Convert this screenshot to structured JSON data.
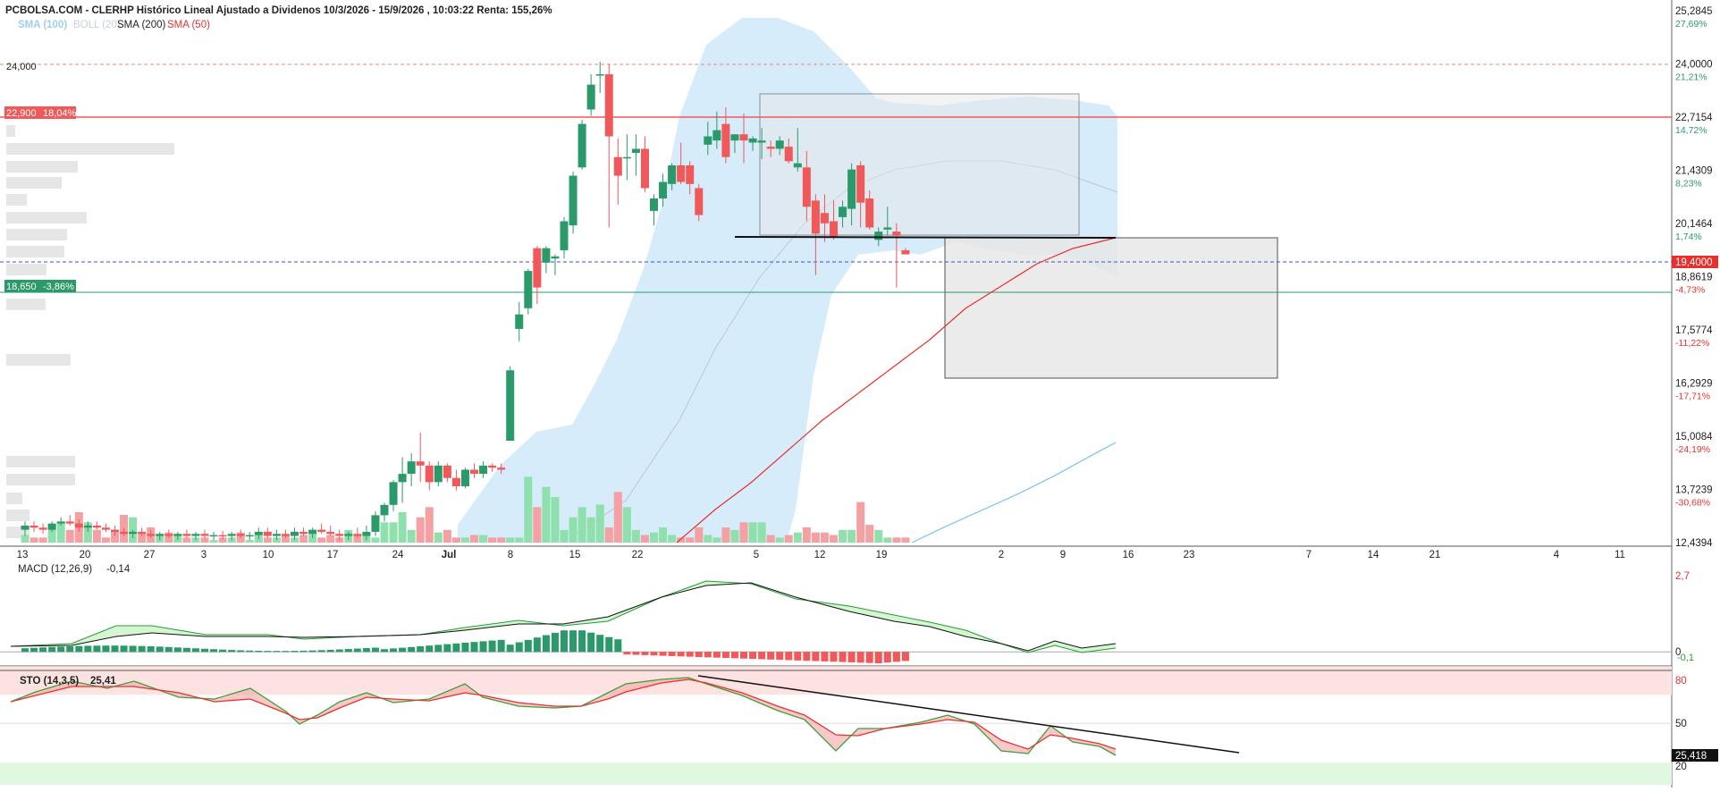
{
  "header": {
    "title": "PCBOLSA.COM - CLERHP Histórico Lineal Ajustado a Dividenos 10/3/2026 - 15/9/2026 , 10:03:22 Renta: 155,26%",
    "legend": [
      {
        "label": "SMA (100)",
        "color": "#9ecff0"
      },
      {
        "label": "BOLL (20)",
        "color": "#d0d8e0"
      },
      {
        "label": "SMA (200)",
        "color": "#222222"
      },
      {
        "label": "SMA (50)",
        "color": "#e8312f"
      }
    ]
  },
  "colors": {
    "up": "#2a9a6a",
    "down": "#f0585a",
    "up_vol": "#8fe0ad",
    "down_vol": "#f5a0a2",
    "boll": "#cfe9fa",
    "sma50": "#e8312f",
    "sma100": "#6fc0f0"
  },
  "price_axis": {
    "ticks": [
      {
        "value": 25.2845,
        "label": "25,2845",
        "pct": "27,69%",
        "pct_color": "#2a9a6a"
      },
      {
        "value": 24.0,
        "label": "24,0000",
        "pct": "21,21%",
        "pct_color": "#2a9a6a"
      },
      {
        "value": 22.7154,
        "label": "22,7154",
        "pct": "14,72%",
        "pct_color": "#2a9a6a"
      },
      {
        "value": 21.4309,
        "label": "21,4309",
        "pct": "8,23%",
        "pct_color": "#2a9a6a"
      },
      {
        "value": 20.1464,
        "label": "20,1464",
        "pct": "1,74%",
        "pct_color": "#2a9a6a"
      },
      {
        "value": 18.8619,
        "label": "18,8619",
        "pct": "-4,73%",
        "pct_color": "#e8312f"
      },
      {
        "value": 17.5774,
        "label": "17,5774",
        "pct": "-11,22%",
        "pct_color": "#e8312f"
      },
      {
        "value": 16.2929,
        "label": "16,2929",
        "pct": "-17,71%",
        "pct_color": "#e8312f"
      },
      {
        "value": 15.0084,
        "label": "15,0084",
        "pct": "-24,19%",
        "pct_color": "#e8312f"
      },
      {
        "value": 13.7239,
        "label": "13,7239",
        "pct": "-30,68%",
        "pct_color": "#e8312f"
      },
      {
        "value": 12.4394,
        "label": "12,4394",
        "pct": "",
        "pct_color": "#e8312f"
      }
    ],
    "current": {
      "value": 19.4,
      "label": "19,4000",
      "color": "#e8312f"
    }
  },
  "levels": {
    "resistance_top": {
      "value": 24.0,
      "label": "24,000"
    },
    "resistance": {
      "value": 22.9,
      "label": "22,900",
      "pct": "18,04%",
      "color": "#f0585a"
    },
    "support": {
      "value": 18.65,
      "label": "18,650",
      "pct": "-3,86%",
      "color": "#2a9a6a"
    }
  },
  "x_axis": {
    "labels": [
      {
        "label": "13",
        "bold": false
      },
      {
        "label": "20",
        "bold": false
      },
      {
        "label": "27",
        "bold": false
      },
      {
        "label": "3",
        "bold": false
      },
      {
        "label": "10",
        "bold": false
      },
      {
        "label": "17",
        "bold": false
      },
      {
        "label": "24",
        "bold": false
      },
      {
        "label": "Jul",
        "bold": true
      },
      {
        "label": "8",
        "bold": false
      },
      {
        "label": "15",
        "bold": false
      },
      {
        "label": "22",
        "bold": false
      },
      {
        "label": "5",
        "bold": false
      },
      {
        "label": "12",
        "bold": false
      },
      {
        "label": "19",
        "bold": false
      },
      {
        "label": "2",
        "bold": false
      },
      {
        "label": "9",
        "bold": false
      },
      {
        "label": "16",
        "bold": false
      },
      {
        "label": "23",
        "bold": false
      },
      {
        "label": "7",
        "bold": false
      },
      {
        "label": "14",
        "bold": false
      },
      {
        "label": "21",
        "bold": false
      },
      {
        "label": "4",
        "bold": false
      },
      {
        "label": "11",
        "bold": false
      }
    ]
  },
  "macd": {
    "title": "MACD (12,26,9)",
    "value": "-0,14",
    "ticks": [
      {
        "value": 2.7,
        "label": "2,7"
      },
      {
        "value": 0,
        "label": "0"
      }
    ],
    "current_label": "-0,1"
  },
  "sto": {
    "title": "STO (14,3,5)",
    "value": "25,41",
    "ticks": [
      {
        "value": 80,
        "label": "80"
      },
      {
        "value": 50,
        "label": "50"
      },
      {
        "value": 20,
        "label": "20"
      }
    ],
    "current_label": "25,418"
  },
  "chart_data": {
    "type": "candlestick",
    "ylim": [
      12.4394,
      25.2845
    ],
    "sto_ylim": [
      7,
      87
    ],
    "macd_ylim": [
      -0.5,
      3.2
    ],
    "candles": [
      {
        "o": 12.75,
        "h": 12.95,
        "l": 12.6,
        "c": 12.85
      },
      {
        "o": 12.85,
        "h": 12.95,
        "l": 12.7,
        "c": 12.8
      },
      {
        "o": 12.8,
        "h": 12.9,
        "l": 12.65,
        "c": 12.75
      },
      {
        "o": 12.75,
        "h": 12.95,
        "l": 12.7,
        "c": 12.9
      },
      {
        "o": 12.9,
        "h": 13.05,
        "l": 12.85,
        "c": 12.95
      },
      {
        "o": 12.95,
        "h": 13.1,
        "l": 12.85,
        "c": 12.9
      },
      {
        "o": 12.9,
        "h": 13.0,
        "l": 12.7,
        "c": 12.8
      },
      {
        "o": 12.8,
        "h": 12.95,
        "l": 12.7,
        "c": 12.85
      },
      {
        "o": 12.85,
        "h": 12.95,
        "l": 12.75,
        "c": 12.8
      },
      {
        "o": 12.8,
        "h": 12.9,
        "l": 12.7,
        "c": 12.75
      },
      {
        "o": 12.75,
        "h": 12.85,
        "l": 12.6,
        "c": 12.7
      },
      {
        "o": 12.7,
        "h": 12.8,
        "l": 12.6,
        "c": 12.65
      },
      {
        "o": 12.65,
        "h": 12.75,
        "l": 12.55,
        "c": 12.7
      },
      {
        "o": 12.7,
        "h": 12.8,
        "l": 12.6,
        "c": 12.65
      },
      {
        "o": 12.65,
        "h": 12.75,
        "l": 12.55,
        "c": 12.6
      },
      {
        "o": 12.6,
        "h": 12.7,
        "l": 12.5,
        "c": 12.65
      },
      {
        "o": 12.65,
        "h": 12.75,
        "l": 12.55,
        "c": 12.6
      },
      {
        "o": 12.6,
        "h": 12.7,
        "l": 12.5,
        "c": 12.65
      },
      {
        "o": 12.65,
        "h": 12.75,
        "l": 12.55,
        "c": 12.6
      },
      {
        "o": 12.6,
        "h": 12.7,
        "l": 12.5,
        "c": 12.65
      },
      {
        "o": 12.65,
        "h": 12.75,
        "l": 12.55,
        "c": 12.6
      },
      {
        "o": 12.6,
        "h": 12.7,
        "l": 12.5,
        "c": 12.62
      },
      {
        "o": 12.62,
        "h": 12.72,
        "l": 12.52,
        "c": 12.6
      },
      {
        "o": 12.6,
        "h": 12.7,
        "l": 12.5,
        "c": 12.65
      },
      {
        "o": 12.65,
        "h": 12.75,
        "l": 12.55,
        "c": 12.6
      },
      {
        "o": 12.6,
        "h": 12.7,
        "l": 12.5,
        "c": 12.62
      },
      {
        "o": 12.62,
        "h": 12.8,
        "l": 12.52,
        "c": 12.7
      },
      {
        "o": 12.7,
        "h": 12.8,
        "l": 12.55,
        "c": 12.6
      },
      {
        "o": 12.6,
        "h": 12.75,
        "l": 12.5,
        "c": 12.65
      },
      {
        "o": 12.65,
        "h": 12.75,
        "l": 12.55,
        "c": 12.6
      },
      {
        "o": 12.6,
        "h": 12.8,
        "l": 12.5,
        "c": 12.7
      },
      {
        "o": 12.7,
        "h": 12.8,
        "l": 12.6,
        "c": 12.65
      },
      {
        "o": 12.65,
        "h": 12.8,
        "l": 12.55,
        "c": 12.75
      },
      {
        "o": 12.75,
        "h": 12.9,
        "l": 12.65,
        "c": 12.7
      },
      {
        "o": 12.7,
        "h": 12.85,
        "l": 12.6,
        "c": 12.65
      },
      {
        "o": 12.65,
        "h": 12.75,
        "l": 12.5,
        "c": 12.6
      },
      {
        "o": 12.6,
        "h": 12.7,
        "l": 12.5,
        "c": 12.65
      },
      {
        "o": 12.65,
        "h": 12.8,
        "l": 12.55,
        "c": 12.6
      },
      {
        "o": 12.6,
        "h": 12.85,
        "l": 12.5,
        "c": 12.7
      },
      {
        "o": 12.7,
        "h": 13.2,
        "l": 12.6,
        "c": 13.1
      },
      {
        "o": 13.1,
        "h": 13.4,
        "l": 12.95,
        "c": 13.35
      },
      {
        "o": 13.35,
        "h": 13.95,
        "l": 13.2,
        "c": 13.9
      },
      {
        "o": 13.9,
        "h": 14.5,
        "l": 13.4,
        "c": 14.1
      },
      {
        "o": 14.1,
        "h": 14.6,
        "l": 13.8,
        "c": 14.4
      },
      {
        "o": 14.4,
        "h": 15.1,
        "l": 13.9,
        "c": 14.3
      },
      {
        "o": 14.3,
        "h": 14.4,
        "l": 13.7,
        "c": 13.9
      },
      {
        "o": 13.9,
        "h": 14.4,
        "l": 13.8,
        "c": 14.3
      },
      {
        "o": 14.3,
        "h": 14.35,
        "l": 13.9,
        "c": 14.0
      },
      {
        "o": 14.0,
        "h": 14.2,
        "l": 13.7,
        "c": 13.8
      },
      {
        "o": 13.8,
        "h": 14.25,
        "l": 13.75,
        "c": 14.2
      },
      {
        "o": 14.2,
        "h": 14.35,
        "l": 14.0,
        "c": 14.1
      },
      {
        "o": 14.1,
        "h": 14.4,
        "l": 14.0,
        "c": 14.3
      },
      {
        "o": 14.3,
        "h": 14.35,
        "l": 14.15,
        "c": 14.25
      },
      {
        "o": 14.25,
        "h": 14.35,
        "l": 14.1,
        "c": 14.2
      },
      {
        "o": 14.9,
        "h": 16.7,
        "l": 14.9,
        "c": 16.6
      },
      {
        "o": 17.6,
        "h": 18.25,
        "l": 17.3,
        "c": 17.95
      },
      {
        "o": 18.1,
        "h": 19.05,
        "l": 17.95,
        "c": 19.0
      },
      {
        "o": 19.55,
        "h": 19.6,
        "l": 18.2,
        "c": 18.6
      },
      {
        "o": 19.2,
        "h": 19.6,
        "l": 18.95,
        "c": 19.55
      },
      {
        "o": 19.3,
        "h": 19.4,
        "l": 18.9,
        "c": 19.35
      },
      {
        "o": 19.5,
        "h": 20.3,
        "l": 19.3,
        "c": 20.2
      },
      {
        "o": 20.1,
        "h": 21.4,
        "l": 19.9,
        "c": 21.3
      },
      {
        "o": 21.5,
        "h": 22.65,
        "l": 21.45,
        "c": 22.55
      },
      {
        "o": 22.9,
        "h": 23.75,
        "l": 22.75,
        "c": 23.5
      },
      {
        "o": 23.75,
        "h": 24.05,
        "l": 23.3,
        "c": 23.75
      },
      {
        "o": 23.75,
        "h": 24.0,
        "l": 20.05,
        "c": 22.25
      },
      {
        "o": 21.75,
        "h": 22.2,
        "l": 20.6,
        "c": 21.3
      },
      {
        "o": 21.75,
        "h": 22.3,
        "l": 21.2,
        "c": 21.75
      },
      {
        "o": 21.85,
        "h": 22.3,
        "l": 21.3,
        "c": 21.95
      },
      {
        "o": 21.95,
        "h": 22.25,
        "l": 20.9,
        "c": 21.0
      },
      {
        "o": 20.45,
        "h": 20.85,
        "l": 20.1,
        "c": 20.75
      },
      {
        "o": 20.75,
        "h": 21.35,
        "l": 20.55,
        "c": 21.15
      },
      {
        "o": 21.1,
        "h": 21.6,
        "l": 20.95,
        "c": 21.55
      },
      {
        "o": 21.55,
        "h": 22.1,
        "l": 21.1,
        "c": 21.15
      },
      {
        "o": 21.55,
        "h": 21.65,
        "l": 20.85,
        "c": 21.1
      },
      {
        "o": 21.0,
        "h": 21.1,
        "l": 20.2,
        "c": 20.35
      },
      {
        "o": 22.05,
        "h": 22.6,
        "l": 21.8,
        "c": 22.25
      },
      {
        "o": 22.15,
        "h": 22.85,
        "l": 21.95,
        "c": 22.4
      },
      {
        "o": 22.55,
        "h": 22.95,
        "l": 21.6,
        "c": 21.75
      },
      {
        "o": 22.15,
        "h": 22.3,
        "l": 21.85,
        "c": 22.3
      },
      {
        "o": 22.3,
        "h": 22.8,
        "l": 21.6,
        "c": 22.15
      },
      {
        "o": 22.1,
        "h": 22.25,
        "l": 21.9,
        "c": 22.2
      },
      {
        "o": 22.1,
        "h": 22.45,
        "l": 21.7,
        "c": 22.15
      },
      {
        "o": 22.0,
        "h": 22.15,
        "l": 21.75,
        "c": 21.95
      },
      {
        "o": 21.95,
        "h": 22.25,
        "l": 21.8,
        "c": 22.15
      },
      {
        "o": 22.0,
        "h": 22.2,
        "l": 21.6,
        "c": 21.65
      },
      {
        "o": 21.5,
        "h": 22.45,
        "l": 21.4,
        "c": 21.6
      },
      {
        "o": 21.5,
        "h": 21.9,
        "l": 20.2,
        "c": 20.55
      },
      {
        "o": 20.7,
        "h": 20.85,
        "l": 18.9,
        "c": 19.9
      },
      {
        "o": 20.4,
        "h": 20.85,
        "l": 19.7,
        "c": 20.15
      },
      {
        "o": 20.2,
        "h": 20.7,
        "l": 19.75,
        "c": 19.8
      },
      {
        "o": 20.3,
        "h": 20.7,
        "l": 20.05,
        "c": 20.55
      },
      {
        "o": 20.5,
        "h": 21.6,
        "l": 20.1,
        "c": 21.45
      },
      {
        "o": 21.55,
        "h": 21.65,
        "l": 20.05,
        "c": 20.65
      },
      {
        "o": 20.75,
        "h": 20.95,
        "l": 20.0,
        "c": 20.05
      },
      {
        "o": 19.75,
        "h": 20.05,
        "l": 19.6,
        "c": 19.95
      },
      {
        "o": 20.0,
        "h": 20.55,
        "l": 19.85,
        "c": 20.05
      },
      {
        "o": 19.95,
        "h": 20.15,
        "l": 18.6,
        "c": 19.85
      },
      {
        "o": 19.5,
        "h": 19.55,
        "l": 19.4,
        "c": 19.4
      }
    ],
    "volumes": [
      3,
      2,
      2,
      6,
      8,
      5,
      12,
      8,
      5,
      2,
      5,
      11,
      10,
      4,
      6,
      3,
      4,
      3,
      2,
      2,
      2,
      1,
      2,
      2,
      4,
      1,
      3,
      2,
      2,
      3,
      2,
      3,
      4,
      2,
      3,
      2,
      5,
      3,
      3,
      2,
      8,
      8,
      12,
      5,
      10,
      14,
      4,
      5,
      2,
      2,
      3,
      3,
      2,
      2,
      2,
      2,
      26,
      14,
      22,
      18,
      5,
      10,
      14,
      10,
      15,
      6,
      20,
      14,
      5,
      3,
      4,
      6,
      3,
      2,
      2,
      6,
      3,
      2,
      6,
      5,
      8,
      8,
      8,
      3,
      2,
      3,
      4,
      6,
      4,
      4,
      3,
      5,
      5,
      16,
      7,
      5,
      2,
      2,
      2,
      7,
      2,
      1,
      7
    ]
  }
}
